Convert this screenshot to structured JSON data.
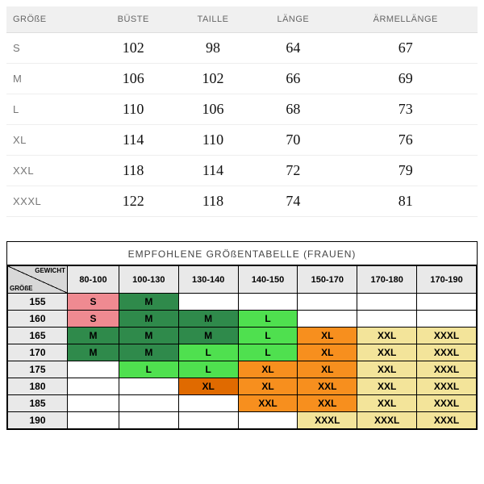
{
  "measurements": {
    "headers": [
      "GRÖßE",
      "BÜSTE",
      "TAILLE",
      "LÄNGE",
      "ÄRMELLÄNGE"
    ],
    "rows": [
      {
        "size": "S",
        "bust": "102",
        "waist": "98",
        "length": "64",
        "sleeve": "67"
      },
      {
        "size": "M",
        "bust": "106",
        "waist": "102",
        "length": "66",
        "sleeve": "69"
      },
      {
        "size": "L",
        "bust": "110",
        "waist": "106",
        "length": "68",
        "sleeve": "73"
      },
      {
        "size": "XL",
        "bust": "114",
        "waist": "110",
        "length": "70",
        "sleeve": "76"
      },
      {
        "size": "XXL",
        "bust": "118",
        "waist": "114",
        "length": "72",
        "sleeve": "79"
      },
      {
        "size": "XXXL",
        "bust": "122",
        "waist": "118",
        "length": "74",
        "sleeve": "81"
      }
    ]
  },
  "recommended": {
    "title": "EMPFOHLENE GRÖßENTABELLE (FRAUEN)",
    "corner_weight": "GEWICHT",
    "corner_height": "GRÖßE",
    "weight_headers": [
      "80-100",
      "100-130",
      "130-140",
      "140-150",
      "150-170",
      "170-180",
      "170-190"
    ],
    "height_labels": [
      "155",
      "160",
      "165",
      "170",
      "175",
      "180",
      "185",
      "190"
    ],
    "grid": [
      [
        {
          "v": "S",
          "c": "pink"
        },
        {
          "v": "M",
          "c": "dgreen"
        },
        {
          "v": "",
          "c": ""
        },
        {
          "v": "",
          "c": ""
        },
        {
          "v": "",
          "c": ""
        },
        {
          "v": "",
          "c": ""
        },
        {
          "v": "",
          "c": ""
        }
      ],
      [
        {
          "v": "S",
          "c": "pink"
        },
        {
          "v": "M",
          "c": "dgreen"
        },
        {
          "v": "M",
          "c": "dgreen"
        },
        {
          "v": "L",
          "c": "lgreen"
        },
        {
          "v": "",
          "c": ""
        },
        {
          "v": "",
          "c": ""
        },
        {
          "v": "",
          "c": ""
        }
      ],
      [
        {
          "v": "M",
          "c": "dgreen"
        },
        {
          "v": "M",
          "c": "dgreen"
        },
        {
          "v": "M",
          "c": "dgreen"
        },
        {
          "v": "L",
          "c": "lgreen"
        },
        {
          "v": "XL",
          "c": "orange"
        },
        {
          "v": "XXL",
          "c": "cream"
        },
        {
          "v": "XXXL",
          "c": "cream"
        }
      ],
      [
        {
          "v": "M",
          "c": "dgreen"
        },
        {
          "v": "M",
          "c": "dgreen"
        },
        {
          "v": "L",
          "c": "lgreen"
        },
        {
          "v": "L",
          "c": "lgreen"
        },
        {
          "v": "XL",
          "c": "orange"
        },
        {
          "v": "XXL",
          "c": "cream"
        },
        {
          "v": "XXXL",
          "c": "cream"
        }
      ],
      [
        {
          "v": "",
          "c": ""
        },
        {
          "v": "L",
          "c": "lgreen"
        },
        {
          "v": "L",
          "c": "lgreen"
        },
        {
          "v": "XL",
          "c": "orange"
        },
        {
          "v": "XL",
          "c": "orange"
        },
        {
          "v": "XXL",
          "c": "cream"
        },
        {
          "v": "XXXL",
          "c": "cream"
        }
      ],
      [
        {
          "v": "",
          "c": ""
        },
        {
          "v": "",
          "c": ""
        },
        {
          "v": "XL",
          "c": "dorange"
        },
        {
          "v": "XL",
          "c": "orange"
        },
        {
          "v": "XXL",
          "c": "orange"
        },
        {
          "v": "XXL",
          "c": "cream"
        },
        {
          "v": "XXXL",
          "c": "cream"
        }
      ],
      [
        {
          "v": "",
          "c": ""
        },
        {
          "v": "",
          "c": ""
        },
        {
          "v": "",
          "c": ""
        },
        {
          "v": "XXL",
          "c": "orange"
        },
        {
          "v": "XXL",
          "c": "orange"
        },
        {
          "v": "XXL",
          "c": "cream"
        },
        {
          "v": "XXXL",
          "c": "cream"
        }
      ],
      [
        {
          "v": "",
          "c": ""
        },
        {
          "v": "",
          "c": ""
        },
        {
          "v": "",
          "c": ""
        },
        {
          "v": "",
          "c": ""
        },
        {
          "v": "XXXL",
          "c": "cream"
        },
        {
          "v": "XXXL",
          "c": "cream"
        },
        {
          "v": "XXXL",
          "c": "cream"
        }
      ]
    ]
  },
  "colors": {
    "pink": "#ef8a91",
    "dgreen": "#2f8a4b",
    "lgreen": "#4fe04f",
    "orange": "#f78f1e",
    "dorange": "#e06a00",
    "cream": "#f3e49a"
  }
}
